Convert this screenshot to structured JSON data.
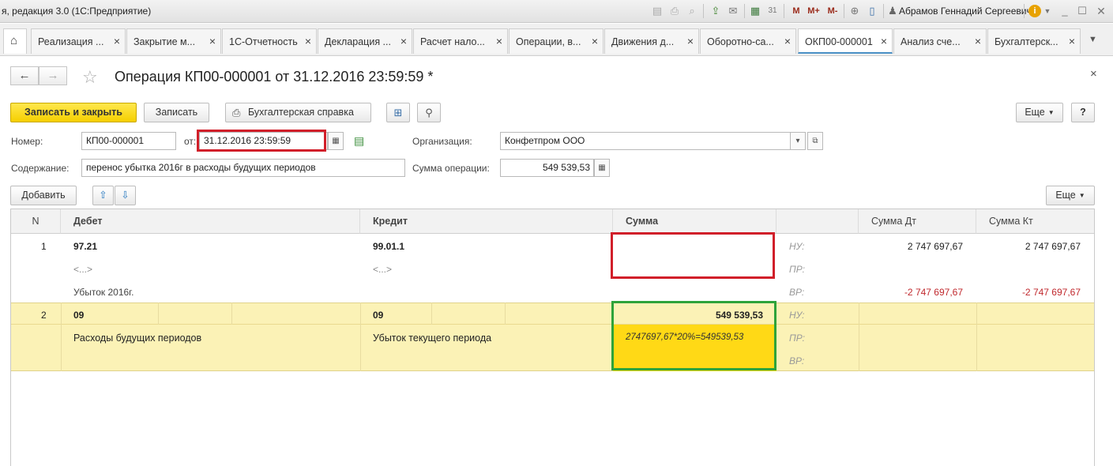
{
  "titlebar": {
    "title": "я, редакция 3.0  (1С:Предприятие)",
    "user": "Абрамов Геннадий Сергеевич",
    "m_labels": [
      "M",
      "M+",
      "M-"
    ]
  },
  "tabs": [
    {
      "label": "Реализация ...",
      "active": false
    },
    {
      "label": "Закрытие м...",
      "active": false
    },
    {
      "label": "1С-Отчетность",
      "active": false
    },
    {
      "label": "Декларация ...",
      "active": false
    },
    {
      "label": "Расчет нало...",
      "active": false
    },
    {
      "label": "Операции, в...",
      "active": false
    },
    {
      "label": "Движения д...",
      "active": false
    },
    {
      "label": "Оборотно-са...",
      "active": false
    },
    {
      "label": "ОКП00-000001",
      "active": true
    },
    {
      "label": "Анализ сче...",
      "active": false
    },
    {
      "label": "Бухгалтерск...",
      "active": false
    }
  ],
  "form": {
    "title": "Операция КП00-000001 от 31.12.2016 23:59:59 *",
    "toolbar": {
      "save_close": "Записать и закрыть",
      "save": "Записать",
      "report": "Бухгалтерская справка",
      "more": "Еще",
      "help": "?"
    },
    "number_label": "Номер:",
    "number_value": "КП00-000001",
    "date_label": "от:",
    "date_value": "31.12.2016 23:59:59",
    "org_label": "Организация:",
    "org_value": "Конфетпром ООО",
    "content_label": "Содержание:",
    "content_value": "перенос убытка 2016г в расходы будущих периодов",
    "sum_label": "Сумма операции:",
    "sum_value": "549 539,53",
    "add": "Добавить",
    "more2": "Еще"
  },
  "grid": {
    "headers": {
      "n": "N",
      "debit": "Дебет",
      "credit": "Кредит",
      "sum": "Сумма",
      "sum_dt": "Сумма Дт",
      "sum_kt": "Сумма Кт"
    },
    "rows": [
      {
        "n": "1",
        "debit": "97.21",
        "credit": "99.01.1",
        "debit_sub": "<...>",
        "credit_sub": "<...>",
        "debit_sub2": "Убыток 2016г.",
        "sum": "",
        "labels": [
          "НУ:",
          "ПР:",
          "ВР:"
        ],
        "nu_dt": "2 747 697,67",
        "nu_kt": "2 747 697,67",
        "vr_dt": "-2 747 697,67",
        "vr_kt": "-2 747 697,67"
      },
      {
        "n": "2",
        "debit": "09",
        "credit": "09",
        "debit_sub": "Расходы будущих периодов",
        "credit_sub": "Убыток текущего периода",
        "sum": "549 539,53",
        "sum_formula": "2747697,67*20%=549539,53",
        "labels": [
          "НУ:",
          "ПР:",
          "ВР:"
        ]
      }
    ]
  }
}
